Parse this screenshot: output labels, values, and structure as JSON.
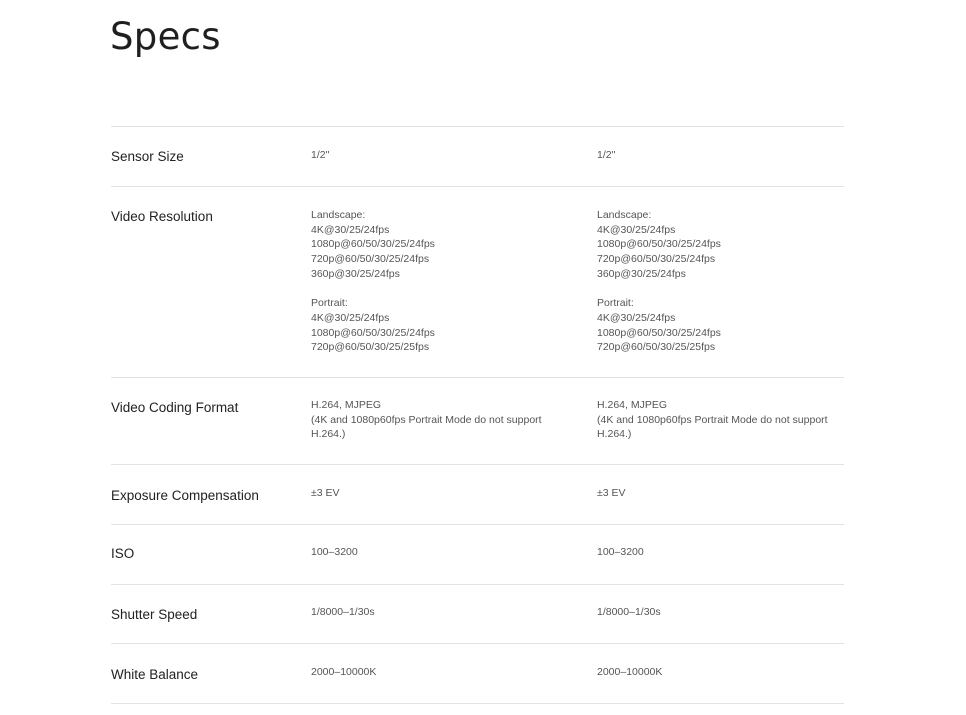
{
  "page": {
    "title": "Specs"
  },
  "specs": {
    "rows": [
      {
        "label": "Sensor Size",
        "values": [
          "1/2\"",
          "1/2\""
        ]
      },
      {
        "label": "Video Resolution",
        "values": [
          "Landscape:\n4K@30/25/24fps\n1080p@60/50/30/25/24fps\n720p@60/50/30/25/24fps\n360p@30/25/24fps\n\nPortrait:\n4K@30/25/24fps\n1080p@60/50/30/25/24fps\n720p@60/50/30/25/25fps",
          "Landscape:\n4K@30/25/24fps\n1080p@60/50/30/25/24fps\n720p@60/50/30/25/24fps\n360p@30/25/24fps\n\nPortrait:\n4K@30/25/24fps\n1080p@60/50/30/25/24fps\n720p@60/50/30/25/25fps"
        ]
      },
      {
        "label": "Video Coding Format",
        "values": [
          "H.264, MJPEG\n(4K and 1080p60fps Portrait Mode do not support H.264.)",
          "H.264, MJPEG\n(4K and 1080p60fps Portrait Mode do not support H.264.)"
        ]
      },
      {
        "label": "Exposure Compensation",
        "values": [
          "±3 EV",
          "±3 EV"
        ]
      },
      {
        "label": "ISO",
        "values": [
          "100–3200",
          "100–3200"
        ]
      },
      {
        "label": "Shutter Speed",
        "values": [
          "1/8000–1/30s",
          "1/8000–1/30s"
        ]
      },
      {
        "label": "White Balance",
        "values": [
          "2000–10000K",
          "2000–10000K"
        ]
      }
    ]
  }
}
